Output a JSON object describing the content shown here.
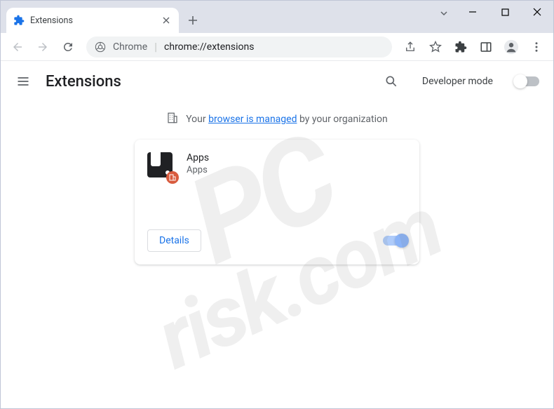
{
  "tab": {
    "title": "Extensions"
  },
  "omnibox": {
    "label": "Chrome",
    "url": "chrome://extensions"
  },
  "page": {
    "title": "Extensions",
    "dev_mode_label": "Developer mode"
  },
  "banner": {
    "prefix": "Your ",
    "link": "browser is managed",
    "suffix": " by your organization"
  },
  "extension": {
    "name": "Apps",
    "description": "Apps",
    "details_label": "Details",
    "enabled": true
  },
  "watermark": {
    "line1": "PC",
    "line2": "risk.com"
  }
}
